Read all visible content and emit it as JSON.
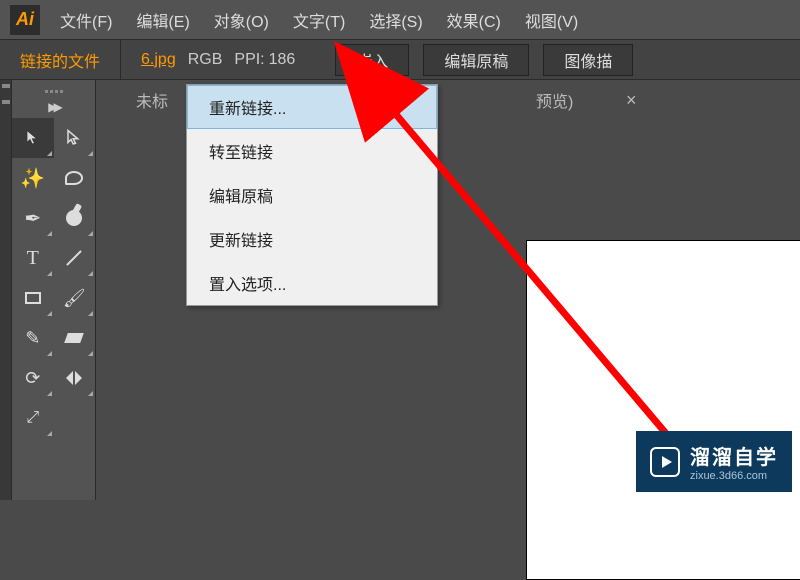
{
  "app": {
    "logo": "Ai"
  },
  "menu": {
    "file": "文件(F)",
    "edit": "编辑(E)",
    "object": "对象(O)",
    "type": "文字(T)",
    "select": "选择(S)",
    "effect": "效果(C)",
    "view": "视图(V)"
  },
  "control": {
    "section_label": "链接的文件",
    "filename": "6.jpg",
    "color_mode": "RGB",
    "ppi_label": "PPI:",
    "ppi_value": "186",
    "embed_btn": "嵌入",
    "edit_original_btn": "编辑原稿",
    "image_trace_btn": "图像描"
  },
  "doc_tab": {
    "prefix": "未标",
    "preview": "预览)",
    "close": "×"
  },
  "context_menu": {
    "items": [
      {
        "label": "重新链接...",
        "hover": true
      },
      {
        "label": "转至链接"
      },
      {
        "label": "编辑原稿"
      },
      {
        "label": "更新链接"
      },
      {
        "label": "置入选项..."
      }
    ]
  },
  "tools": [
    {
      "name": "selection-tool",
      "selected": true,
      "corner": true
    },
    {
      "name": "direct-selection-tool",
      "corner": true
    },
    {
      "name": "magic-wand-tool",
      "corner": false
    },
    {
      "name": "lasso-tool",
      "corner": false
    },
    {
      "name": "pen-tool",
      "corner": true
    },
    {
      "name": "blob-brush-tool",
      "corner": true
    },
    {
      "name": "type-tool",
      "corner": true
    },
    {
      "name": "line-tool",
      "corner": true
    },
    {
      "name": "rectangle-tool",
      "corner": true
    },
    {
      "name": "paintbrush-tool",
      "corner": true
    },
    {
      "name": "pencil-tool",
      "corner": true
    },
    {
      "name": "eraser-tool",
      "corner": true
    },
    {
      "name": "rotate-tool",
      "corner": true
    },
    {
      "name": "reflect-tool",
      "corner": true
    },
    {
      "name": "scale-tool",
      "corner": true
    }
  ],
  "watermark": {
    "title": "溜溜自学",
    "sub": "zixue.3d66.com"
  }
}
